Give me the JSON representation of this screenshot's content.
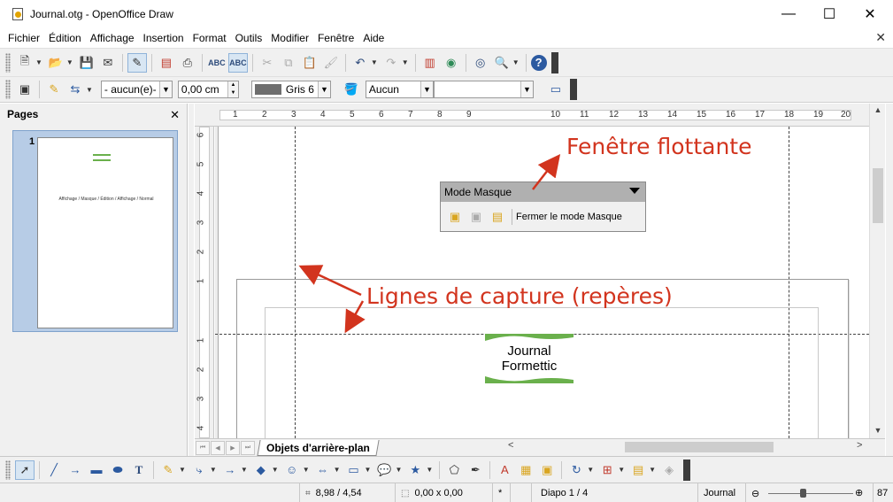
{
  "window": {
    "title": "Journal.otg - OpenOffice Draw",
    "minimize": "—",
    "maximize": "☐",
    "close": "✕"
  },
  "menu": {
    "items": [
      "Fichier",
      "Édition",
      "Affichage",
      "Insertion",
      "Format",
      "Outils",
      "Modifier",
      "Fenêtre",
      "Aide"
    ],
    "close": "✕"
  },
  "toolbar2": {
    "line_style": "- aucun(e)-",
    "line_width": "0,00 cm",
    "fill_color_name": "Gris 6",
    "area_style": "Aucun",
    "area_value": ""
  },
  "pages_panel": {
    "title": "Pages",
    "close": "✕",
    "slide_number": "1",
    "thumb_text": "Affichage / Masque / Édition / Affichage / Normal"
  },
  "hruler": {
    "ticks": [
      "1",
      "2",
      "3",
      "4",
      "5",
      "6",
      "7",
      "8",
      "9",
      "10",
      "11",
      "12",
      "13",
      "14",
      "15",
      "16",
      "17",
      "18",
      "19",
      "20"
    ]
  },
  "vruler": {
    "ticks_top": [
      "6",
      "5",
      "4",
      "3",
      "2",
      "1"
    ],
    "ticks_bottom": [
      "1",
      "2",
      "3",
      "4"
    ]
  },
  "floating_toolbar": {
    "title": "Mode Masque",
    "close_label": "Fermer le mode Masque"
  },
  "canvas": {
    "logo_line1": "Journal",
    "logo_line2": "Formettic"
  },
  "annotations": {
    "floating_window": "Fenêtre flottante",
    "snap_lines": "Lignes de capture (repères)"
  },
  "tabs": {
    "active": "Objets d'arrière-plan"
  },
  "status": {
    "position": "8,98 / 4,54",
    "size": "0,00 x 0,00",
    "modified": "*",
    "slide": "Diapo 1 / 4",
    "master": "Journal",
    "zoom": "87"
  },
  "colors": {
    "annotation": "#d2341e",
    "logo_green": "#6ab04c",
    "fill_swatch": "#6e6e6e"
  }
}
